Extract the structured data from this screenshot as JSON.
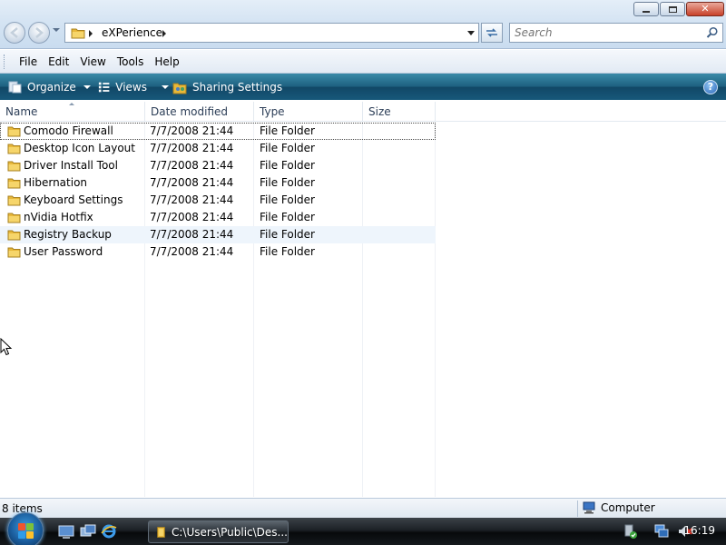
{
  "window": {
    "address": {
      "location": "eXPerience"
    },
    "search": {
      "placeholder": "Search"
    }
  },
  "menu": [
    "File",
    "Edit",
    "View",
    "Tools",
    "Help"
  ],
  "command_bar": {
    "organize": "Organize",
    "views": "Views",
    "sharing": "Sharing Settings",
    "help_glyph": "?"
  },
  "columns": {
    "name": "Name",
    "date": "Date modified",
    "type": "Type",
    "size": "Size"
  },
  "files": [
    {
      "name": "Comodo Firewall",
      "date": "7/7/2008 21:44",
      "type": "File Folder",
      "size": ""
    },
    {
      "name": "Desktop Icon Layout",
      "date": "7/7/2008 21:44",
      "type": "File Folder",
      "size": ""
    },
    {
      "name": "Driver Install Tool",
      "date": "7/7/2008 21:44",
      "type": "File Folder",
      "size": ""
    },
    {
      "name": "Hibernation",
      "date": "7/7/2008 21:44",
      "type": "File Folder",
      "size": ""
    },
    {
      "name": "Keyboard Settings",
      "date": "7/7/2008 21:44",
      "type": "File Folder",
      "size": ""
    },
    {
      "name": "nVidia Hotfix",
      "date": "7/7/2008 21:44",
      "type": "File Folder",
      "size": ""
    },
    {
      "name": "Registry Backup",
      "date": "7/7/2008 21:44",
      "type": "File Folder",
      "size": ""
    },
    {
      "name": "User Password",
      "date": "7/7/2008 21:44",
      "type": "File Folder",
      "size": ""
    }
  ],
  "status": {
    "item_count": "8 items",
    "location": "Computer"
  },
  "taskbar": {
    "window_button": "C:\\Users\\Public\\Des...",
    "clock": "16:19"
  },
  "colors": {
    "command_bar": "#17587a",
    "folder": "#e8b83a",
    "selection_hover": "#eef5fc"
  }
}
